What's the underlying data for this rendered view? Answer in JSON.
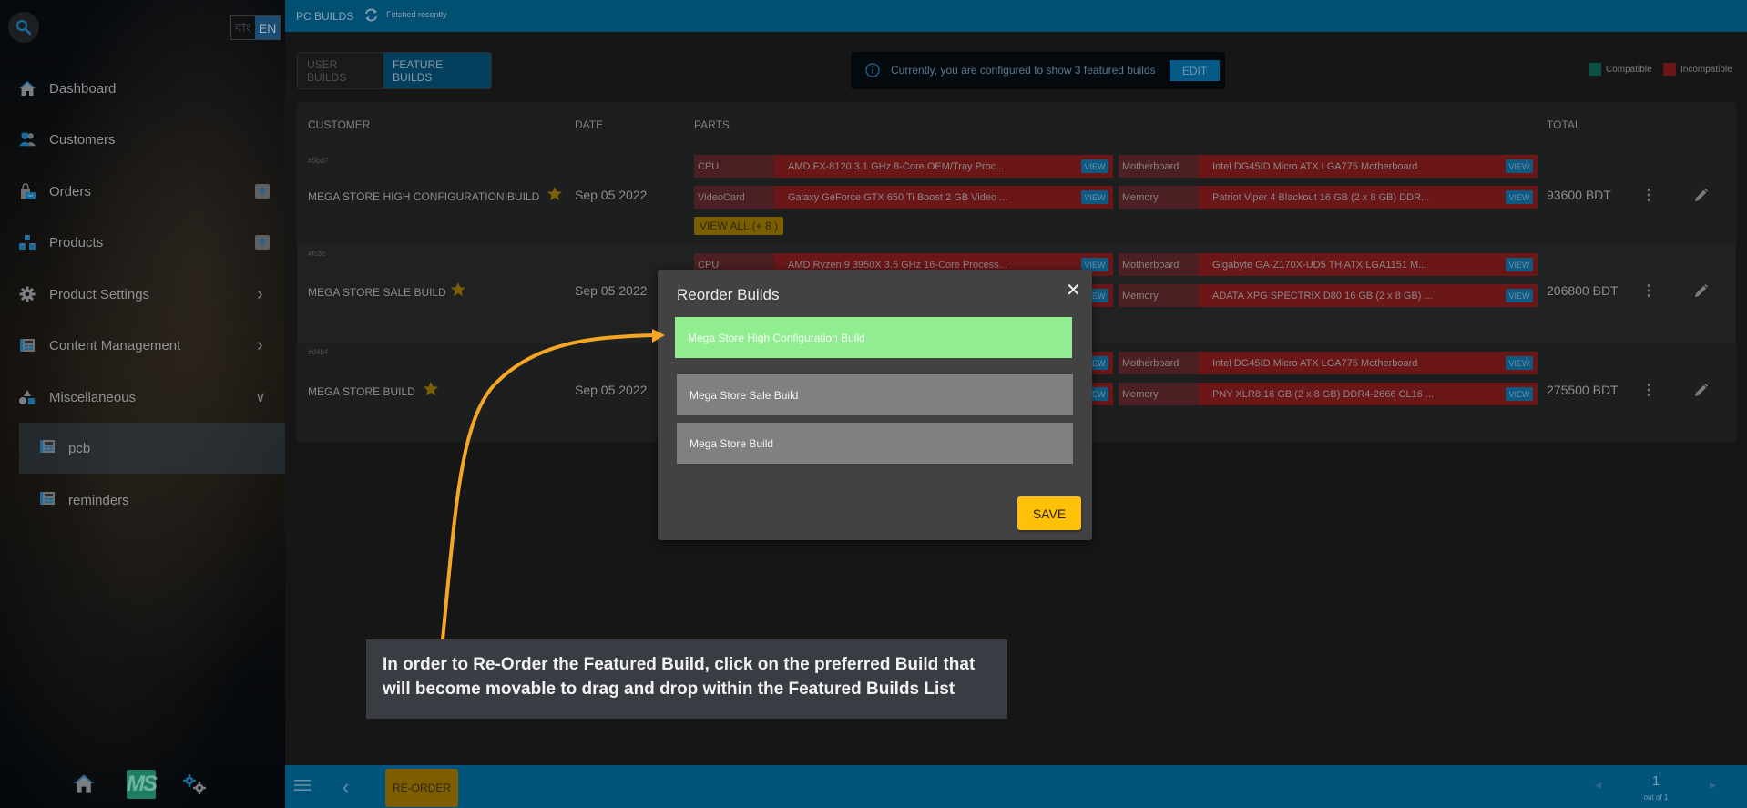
{
  "sidebar": {
    "lang": {
      "bn": "বাং",
      "en": "EN"
    },
    "items": [
      {
        "label": "Dashboard",
        "icon": "home-icon"
      },
      {
        "label": "Customers",
        "icon": "users-icon"
      },
      {
        "label": "Orders",
        "icon": "shopping-bag-icon",
        "has_add": true
      },
      {
        "label": "Products",
        "icon": "boxes-icon",
        "has_add": true
      },
      {
        "label": "Product Settings",
        "icon": "gear-icon",
        "has_chevron": "right"
      },
      {
        "label": "Content Management",
        "icon": "table-icon",
        "has_chevron": "right"
      },
      {
        "label": "Miscellaneous",
        "icon": "shapes-icon",
        "has_chevron": "down"
      }
    ],
    "sub_items": [
      {
        "label": "pcb",
        "active": true
      },
      {
        "label": "reminders",
        "active": false
      }
    ],
    "footer": {
      "logo": "MS"
    }
  },
  "header": {
    "title": "PC BUILDS",
    "status": "Fetched recently"
  },
  "tabs": [
    {
      "label": "USER BUILDS",
      "active": false
    },
    {
      "label": "FEATURE BUILDS",
      "active": true
    }
  ],
  "info": {
    "message": "Currently, you are configured to show 3 featured builds",
    "edit_label": "EDIT"
  },
  "legend": [
    {
      "label": "Compatible",
      "color": "#0c4f45"
    },
    {
      "label": "Incompatible",
      "color": "#6b1718"
    }
  ],
  "table": {
    "columns": [
      "CUSTOMER",
      "DATE",
      "PARTS",
      "TOTAL"
    ],
    "rows": [
      {
        "id": "#5bd7",
        "name": "MEGA STORE HIGH CONFIGURATION BUILD",
        "date": "Sep 05 2022",
        "parts": [
          {
            "type": "CPU",
            "name": "AMD FX-8120 3.1 GHz 8-Core OEM/Tray Proc...",
            "view": "VIEW"
          },
          {
            "type": "Motherboard",
            "name": "Intel DG45ID Micro ATX LGA775 Motherboard",
            "view": "VIEW"
          },
          {
            "type": "VideoCard",
            "name": "Galaxy GeForce GTX 650 Ti Boost 2 GB Video ...",
            "view": "VIEW"
          },
          {
            "type": "Memory",
            "name": "Patriot Viper 4 Blackout 16 GB (2 x 8 GB) DDR...",
            "view": "VIEW"
          }
        ],
        "view_all": "VIEW ALL (+ 8 )",
        "total": "93600 BDT"
      },
      {
        "id": "#fc3c",
        "name": "MEGA STORE SALE BUILD",
        "date": "Sep 05 2022",
        "parts": [
          {
            "type": "CPU",
            "name": "AMD Ryzen 9 3950X 3.5 GHz 16-Core Process...",
            "view": "VIEW"
          },
          {
            "type": "Motherboard",
            "name": "Gigabyte GA-Z170X-UD5 TH ATX LGA1151 M...",
            "view": "VIEW"
          },
          {
            "type": "",
            "name": "",
            "view": "VIEW"
          },
          {
            "type": "Memory",
            "name": "ADATA XPG SPECTRIX D80 16 GB (2 x 8 GB) ...",
            "view": "VIEW"
          }
        ],
        "total": "206800 BDT"
      },
      {
        "id": "#d4b4",
        "name": "MEGA STORE BUILD",
        "date": "Sep 05 2022",
        "parts": [
          {
            "type": "",
            "name": "",
            "view": "VIEW"
          },
          {
            "type": "Motherboard",
            "name": "Intel DG45ID Micro ATX LGA775 Motherboard",
            "view": "VIEW"
          },
          {
            "type": "",
            "name": "",
            "view": "VIEW"
          },
          {
            "type": "Memory",
            "name": "PNY XLR8 16 GB (2 x 8 GB) DDR4-2666 CL16 ...",
            "view": "VIEW"
          }
        ],
        "total": "275500 BDT"
      }
    ]
  },
  "modal": {
    "title": "Reorder Builds",
    "items": [
      {
        "label": "Mega Store High Configuration Build",
        "selected": true
      },
      {
        "label": "Mega Store Sale Build",
        "selected": false
      },
      {
        "label": "Mega Store Build",
        "selected": false
      }
    ],
    "save_label": "SAVE"
  },
  "bottombar": {
    "reorder_label": "RE-ORDER",
    "page": "1",
    "page_total": "out of 1"
  },
  "tutorial": {
    "text": "In order to Re-Order the Featured Build, click on the preferred Build that will become movable to drag and drop within the Featured Builds List",
    "arrow_color": "#f5a623"
  }
}
